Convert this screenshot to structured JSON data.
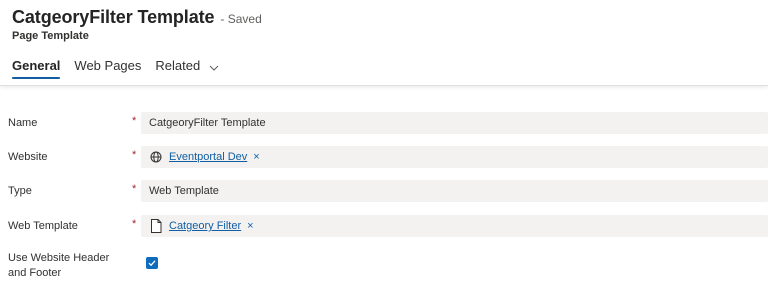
{
  "header": {
    "title": "CatgeoryFilter Template",
    "saved_status": "- Saved",
    "subtitle": "Page Template"
  },
  "tabs": [
    {
      "label": "General",
      "active": true
    },
    {
      "label": "Web Pages",
      "active": false
    },
    {
      "label": "Related",
      "active": false
    }
  ],
  "fields": {
    "name": {
      "label": "Name",
      "required": "*",
      "value": "CatgeoryFilter Template"
    },
    "website": {
      "label": "Website",
      "required": "*",
      "value": "Eventportal Dev",
      "icon": "globe-icon",
      "remove": "×"
    },
    "type": {
      "label": "Type",
      "required": "*",
      "value": "Web Template"
    },
    "web_template": {
      "label": "Web Template",
      "required": "*",
      "value": "Catgeory Filter",
      "icon": "document-icon",
      "remove": "×"
    },
    "use_header_footer": {
      "label": "Use Website Header and Footer",
      "checked": true
    }
  },
  "colors": {
    "accent": "#115ea3",
    "required": "#a4262c",
    "field_bg": "#f3f2f1",
    "checkbox": "#0f6cbd"
  }
}
